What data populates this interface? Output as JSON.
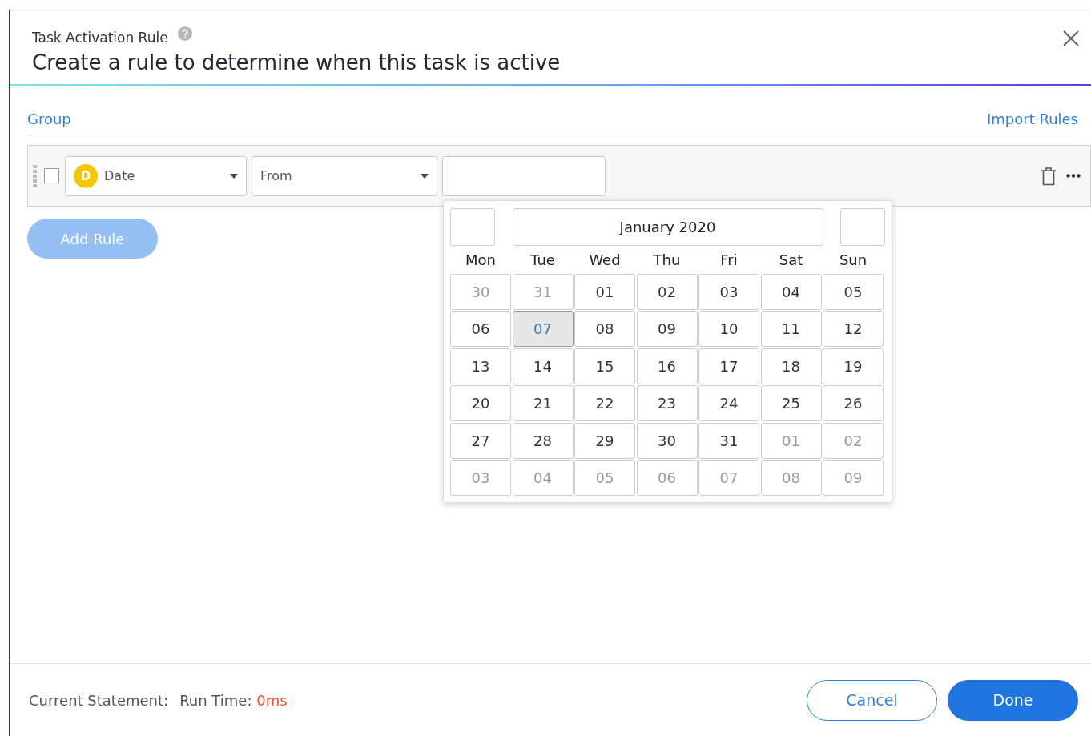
{
  "dialog": {
    "subtitle": "Task Activation Rule",
    "title": "Create a rule to determine when this task is active"
  },
  "toolbar": {
    "group_link": "Group",
    "import_link": "Import Rules"
  },
  "rule": {
    "checked": false,
    "field": {
      "badge": "D",
      "label": "Date"
    },
    "operator": "From"
  },
  "add_rule_button": {
    "label": "Add Rule",
    "disabled": true
  },
  "calendar": {
    "month": "January 2020",
    "weekdays": [
      "Mon",
      "Tue",
      "Wed",
      "Thu",
      "Fri",
      "Sat",
      "Sun"
    ],
    "days": [
      {
        "label": "30",
        "outside": true,
        "selected": false
      },
      {
        "label": "31",
        "outside": true,
        "selected": false
      },
      {
        "label": "01",
        "outside": false,
        "selected": false
      },
      {
        "label": "02",
        "outside": false,
        "selected": false
      },
      {
        "label": "03",
        "outside": false,
        "selected": false
      },
      {
        "label": "04",
        "outside": false,
        "selected": false
      },
      {
        "label": "05",
        "outside": false,
        "selected": false
      },
      {
        "label": "06",
        "outside": false,
        "selected": false
      },
      {
        "label": "07",
        "outside": false,
        "selected": true
      },
      {
        "label": "08",
        "outside": false,
        "selected": false
      },
      {
        "label": "09",
        "outside": false,
        "selected": false
      },
      {
        "label": "10",
        "outside": false,
        "selected": false
      },
      {
        "label": "11",
        "outside": false,
        "selected": false
      },
      {
        "label": "12",
        "outside": false,
        "selected": false
      },
      {
        "label": "13",
        "outside": false,
        "selected": false
      },
      {
        "label": "14",
        "outside": false,
        "selected": false
      },
      {
        "label": "15",
        "outside": false,
        "selected": false
      },
      {
        "label": "16",
        "outside": false,
        "selected": false
      },
      {
        "label": "17",
        "outside": false,
        "selected": false
      },
      {
        "label": "18",
        "outside": false,
        "selected": false
      },
      {
        "label": "19",
        "outside": false,
        "selected": false
      },
      {
        "label": "20",
        "outside": false,
        "selected": false
      },
      {
        "label": "21",
        "outside": false,
        "selected": false
      },
      {
        "label": "22",
        "outside": false,
        "selected": false
      },
      {
        "label": "23",
        "outside": false,
        "selected": false
      },
      {
        "label": "24",
        "outside": false,
        "selected": false
      },
      {
        "label": "25",
        "outside": false,
        "selected": false
      },
      {
        "label": "26",
        "outside": false,
        "selected": false
      },
      {
        "label": "27",
        "outside": false,
        "selected": false
      },
      {
        "label": "28",
        "outside": false,
        "selected": false
      },
      {
        "label": "29",
        "outside": false,
        "selected": false
      },
      {
        "label": "30",
        "outside": false,
        "selected": false
      },
      {
        "label": "31",
        "outside": false,
        "selected": false
      },
      {
        "label": "01",
        "outside": true,
        "selected": false
      },
      {
        "label": "02",
        "outside": true,
        "selected": false
      },
      {
        "label": "03",
        "outside": true,
        "selected": false
      },
      {
        "label": "04",
        "outside": true,
        "selected": false
      },
      {
        "label": "05",
        "outside": true,
        "selected": false
      },
      {
        "label": "06",
        "outside": true,
        "selected": false
      },
      {
        "label": "07",
        "outside": true,
        "selected": false
      },
      {
        "label": "08",
        "outside": true,
        "selected": false
      },
      {
        "label": "09",
        "outside": true,
        "selected": false
      }
    ]
  },
  "footer": {
    "statement_label": "Current Statement:",
    "runtime_label": "Run Time:",
    "runtime_value": "0ms",
    "buttons": [
      {
        "kind": "secondary",
        "label": "Cancel"
      },
      {
        "kind": "primary",
        "label": "Done"
      }
    ]
  }
}
